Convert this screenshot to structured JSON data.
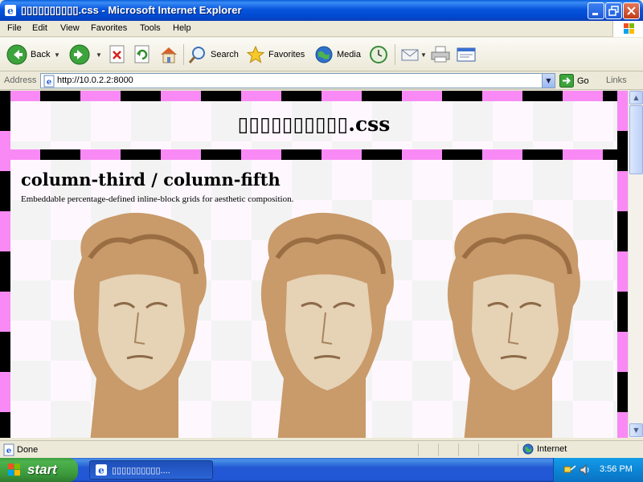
{
  "window": {
    "title": "▯▯▯▯▯▯▯▯▯▯.css - Microsoft Internet Explorer"
  },
  "menu": [
    "File",
    "Edit",
    "View",
    "Favorites",
    "Tools",
    "Help"
  ],
  "toolbar": {
    "back_label": "Back",
    "search_label": "Search",
    "favorites_label": "Favorites",
    "media_label": "Media"
  },
  "address": {
    "label": "Address",
    "url": "http://10.0.2.2:8000",
    "go_label": "Go",
    "links_label": "Links"
  },
  "page": {
    "hero_title": "▯▯▯▯▯▯▯▯▯▯.css",
    "section_title": "column-third / column-fifth",
    "section_desc": "Embeddable percentage-defined inline-block grids for aesthetic composition.",
    "images": [
      "greek-bust",
      "greek-bust",
      "greek-bust"
    ]
  },
  "colors": {
    "pink": "#F98AF5",
    "black": "#000000",
    "xp_blue": "#0855DD",
    "start_green": "#3A983A"
  },
  "status": {
    "text": "Done",
    "zone": "Internet"
  },
  "taskbar": {
    "start_label": "start",
    "task_label": "▯▯▯▯▯▯▯▯▯▯....",
    "clock": "3:56 PM"
  }
}
